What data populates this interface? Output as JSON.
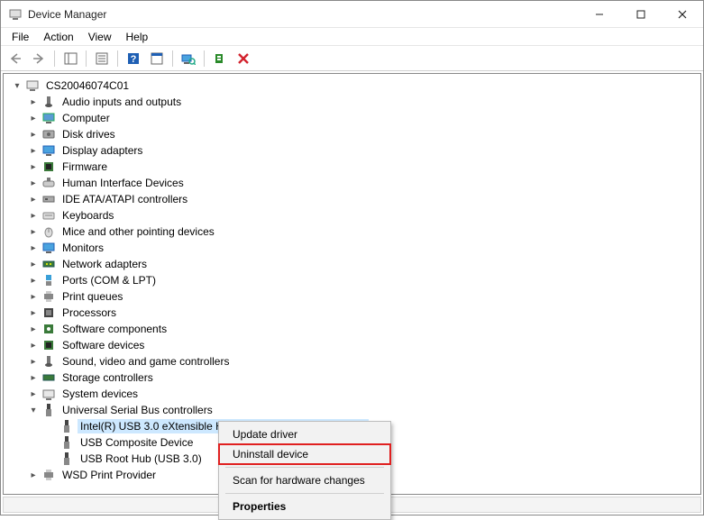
{
  "window": {
    "title": "Device Manager"
  },
  "menu": {
    "items": [
      "File",
      "Action",
      "View",
      "Help"
    ]
  },
  "tree": {
    "root": "CS20046074C01",
    "categories": [
      "Audio inputs and outputs",
      "Computer",
      "Disk drives",
      "Display adapters",
      "Firmware",
      "Human Interface Devices",
      "IDE ATA/ATAPI controllers",
      "Keyboards",
      "Mice and other pointing devices",
      "Monitors",
      "Network adapters",
      "Ports (COM & LPT)",
      "Print queues",
      "Processors",
      "Software components",
      "Software devices",
      "Sound, video and game controllers",
      "Storage controllers",
      "System devices"
    ],
    "usb_category": "Universal Serial Bus controllers",
    "usb_children": [
      "Intel(R) USB 3.0 eXtensible Host Controller - 1.0 (Microsoft)",
      "USB Composite Device",
      "USB Root Hub (USB 3.0)"
    ],
    "last_category": "WSD Print Provider"
  },
  "context_menu": {
    "update": "Update driver",
    "uninstall": "Uninstall device",
    "scan": "Scan for hardware changes",
    "properties": "Properties"
  }
}
